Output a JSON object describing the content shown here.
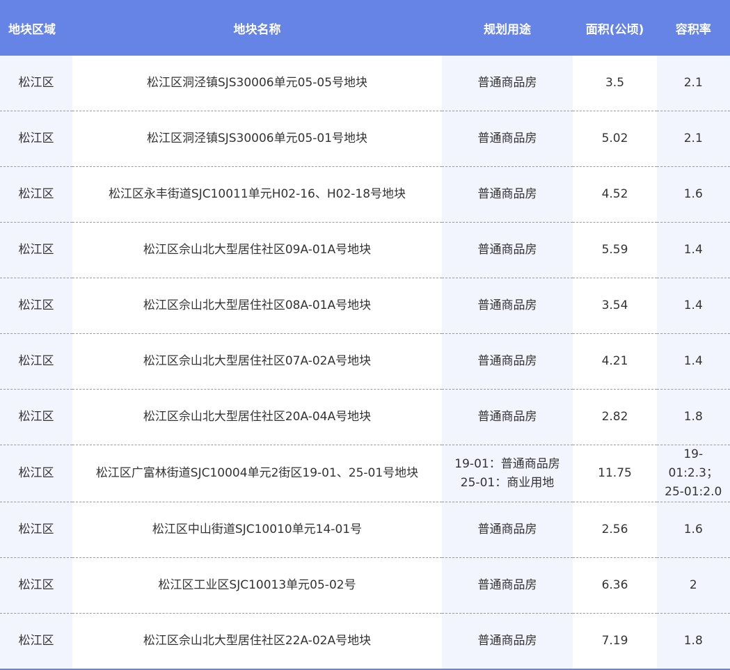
{
  "table": {
    "headers": [
      "地块区域",
      "地块名称",
      "规划用途",
      "面积(公顷)",
      "容积率"
    ],
    "rows": [
      {
        "area": "松江区",
        "name": "松江区洞泾镇SJS30006单元05-05号地块",
        "usage": "普通商品房",
        "size": "3.5",
        "far": "2.1"
      },
      {
        "area": "松江区",
        "name": "松江区洞泾镇SJS30006单元05-01号地块",
        "usage": "普通商品房",
        "size": "5.02",
        "far": "2.1"
      },
      {
        "area": "松江区",
        "name": "松江区永丰街道SJC10011单元H02-16、H02-18号地块",
        "usage": "普通商品房",
        "size": "4.52",
        "far": "1.6"
      },
      {
        "area": "松江区",
        "name": "松江区佘山北大型居住社区09A-01A号地块",
        "usage": "普通商品房",
        "size": "5.59",
        "far": "1.4"
      },
      {
        "area": "松江区",
        "name": "松江区佘山北大型居住社区08A-01A号地块",
        "usage": "普通商品房",
        "size": "3.54",
        "far": "1.4"
      },
      {
        "area": "松江区",
        "name": "松江区佘山北大型居住社区07A-02A号地块",
        "usage": "普通商品房",
        "size": "4.21",
        "far": "1.4"
      },
      {
        "area": "松江区",
        "name": "松江区佘山北大型居住社区20A-04A号地块",
        "usage": "普通商品房",
        "size": "2.82",
        "far": "1.8"
      },
      {
        "area": "松江区",
        "name": "松江区广富林街道SJC10004单元2街区19-01、25-01号地块",
        "usage": "19-01：普通商品房\n25-01：商业用地",
        "size": "11.75",
        "far": "19-01:2.3；\n25-01:2.0"
      },
      {
        "area": "松江区",
        "name": "松江区中山街道SJC10010单元14-01号",
        "usage": "普通商品房",
        "size": "2.56",
        "far": "1.6"
      },
      {
        "area": "松江区",
        "name": "松江区工业区SJC10013单元05-02号",
        "usage": "普通商品房",
        "size": "6.36",
        "far": "2"
      },
      {
        "area": "松江区",
        "name": "松江区佘山北大型居住社区22A-02A号地块",
        "usage": "普通商品房",
        "size": "7.19",
        "far": "1.8"
      }
    ]
  }
}
